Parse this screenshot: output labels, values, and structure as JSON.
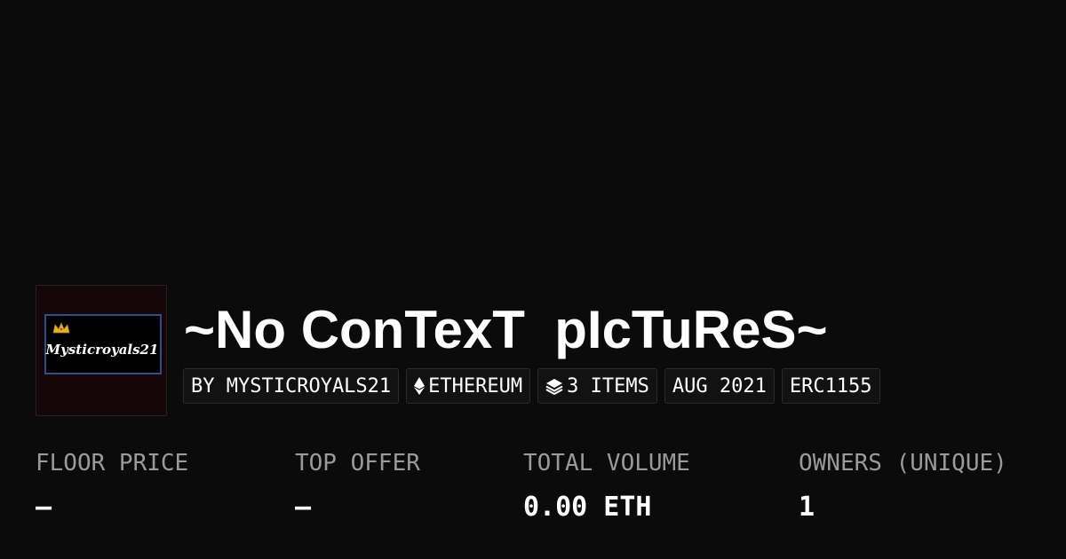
{
  "collection": {
    "title": "~No ConTexT  pIcTuReS~",
    "avatar_text": "Mysticroyals21",
    "avatar_icon": "crown-icon"
  },
  "tags": {
    "creator": "BY MYSTICROYALS21",
    "chain": "ETHEREUM",
    "chain_icon": "ethereum-icon",
    "items": "3 ITEMS",
    "items_icon": "layers-icon",
    "date": "AUG 2021",
    "standard": "ERC1155"
  },
  "stats": [
    {
      "label": "FLOOR PRICE",
      "value": "–"
    },
    {
      "label": "TOP OFFER",
      "value": "–"
    },
    {
      "label": "TOTAL VOLUME",
      "value": "0.00 ETH"
    },
    {
      "label": "OWNERS (UNIQUE)",
      "value": "1"
    }
  ],
  "colors": {
    "background": "#0b0b0b",
    "text": "#ffffff",
    "muted": "#9a9a9a",
    "tag_border": "#2b2b2b",
    "avatar_frame": "#2f4f86",
    "crown": "#e6b325"
  }
}
